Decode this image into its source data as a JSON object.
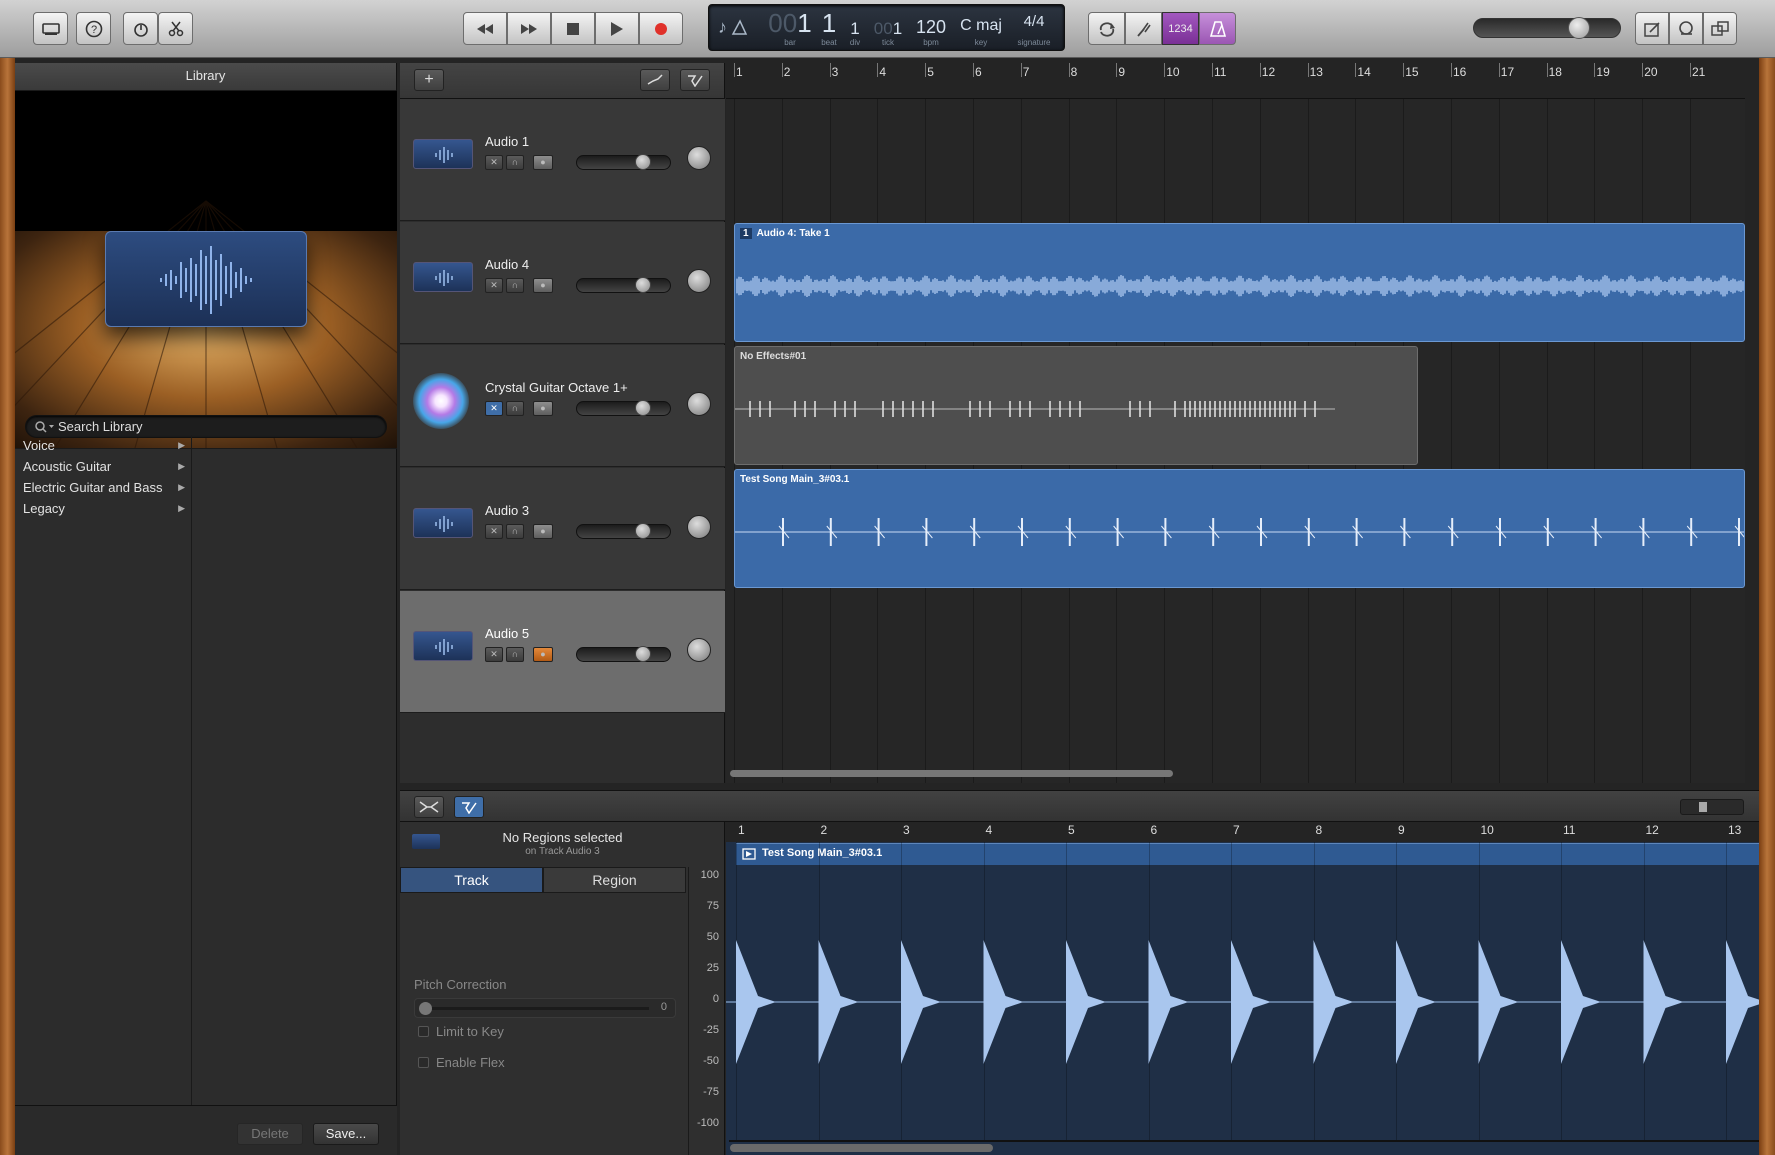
{
  "toolbar": {
    "transport": [
      "rewind",
      "fast-forward",
      "stop",
      "play",
      "record"
    ],
    "lcd": {
      "bar": "1",
      "beat": "1",
      "div": "1",
      "tick": "1",
      "bpm": "120",
      "key": "C maj",
      "signature": "4/4",
      "labels": {
        "bar": "bar",
        "beat": "beat",
        "div": "div",
        "tick": "tick",
        "bpm": "bpm",
        "key": "key",
        "signature": "signature"
      }
    },
    "count_in": "1234",
    "master_volume": 0.6
  },
  "library": {
    "title": "Library",
    "search_placeholder": "Search Library",
    "items": [
      {
        "label": "Voice"
      },
      {
        "label": "Acoustic Guitar"
      },
      {
        "label": "Electric Guitar and Bass"
      },
      {
        "label": "Legacy"
      }
    ],
    "delete_label": "Delete",
    "save_label": "Save..."
  },
  "tracks": [
    {
      "name": "Audio 1",
      "selected": false
    },
    {
      "name": "Audio 4",
      "selected": false
    },
    {
      "name": "Crystal Guitar Octave 1+",
      "selected": false
    },
    {
      "name": "Audio 3",
      "selected": false
    },
    {
      "name": "Audio 5",
      "selected": true
    }
  ],
  "timeline": {
    "bars": [
      "1",
      "2",
      "3",
      "4",
      "5",
      "6",
      "7",
      "8",
      "9",
      "10",
      "11",
      "12",
      "13",
      "14",
      "15",
      "16",
      "17",
      "18",
      "19",
      "20",
      "21"
    ],
    "regions": [
      {
        "name": "Audio 4: Take 1",
        "take": "1"
      },
      {
        "name": "No Effects#01"
      },
      {
        "name": "Test Song Main_3#03.1"
      }
    ]
  },
  "editor": {
    "status": "No Regions selected",
    "substatus": "on Track Audio 3",
    "tabs": [
      {
        "label": "Track"
      },
      {
        "label": "Region"
      }
    ],
    "pitch_correction_label": "Pitch Correction",
    "pitch_value": "0",
    "limit_to_key_label": "Limit to Key",
    "enable_flex_label": "Enable Flex",
    "yaxis": [
      "100",
      "75",
      "50",
      "25",
      "0",
      "-25",
      "-50",
      "-75",
      "-100"
    ],
    "bars": [
      "1",
      "2",
      "3",
      "4",
      "5",
      "6",
      "7",
      "8",
      "9",
      "10",
      "11",
      "12",
      "13"
    ],
    "region_name": "Test Song Main_3#03.1"
  },
  "colors": {
    "region_blue": "#3a6aaa",
    "region_gray": "#555555",
    "accent_purple": "#8e3fa7",
    "record_red": "#e0312a"
  }
}
